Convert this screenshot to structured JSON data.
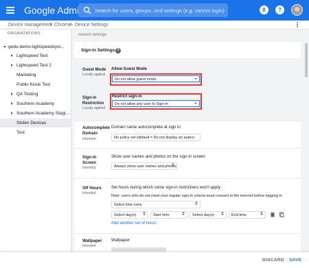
{
  "header": {
    "brand": "Google",
    "product": "Admin",
    "search_placeholder": "Search for users, groups, and settings (e.g. cannot login)",
    "icons": [
      "menu-icon",
      "search-icon",
      "help-number-icon",
      "help-icon",
      "account-avatar"
    ],
    "badge_label": "8",
    "help_label": "?",
    "brand_color": "#1a73e8"
  },
  "breadcrumb": {
    "items": [
      "Device management",
      "Chrome",
      "Device Settings"
    ],
    "separator": ">"
  },
  "orgs": {
    "header": "ORGANIZATIONS",
    "items": [
      {
        "label": "gedu-demo-lightspeedsyst...",
        "expanded": true
      },
      {
        "label": "Lightspeed Test",
        "expanded": false
      },
      {
        "label": "Lightspeed Test 2",
        "expanded": false
      },
      {
        "label": "Marketing",
        "expanded": null
      },
      {
        "label": "Public Kiosk Test",
        "expanded": null
      },
      {
        "label": "QA Testing",
        "expanded": false
      },
      {
        "label": "Southern Academy",
        "expanded": false
      },
      {
        "label": "Southern Academy Stagi...",
        "expanded": false
      },
      {
        "label": "Stolen Devices",
        "selected": true
      },
      {
        "label": "Test",
        "expanded": null
      }
    ]
  },
  "settings": {
    "search_placeholder": "Search settings",
    "section_title": "Sign-in Settings",
    "section_help": "?",
    "guest_mode": {
      "label": "Guest Mode",
      "sub": "Locally applied",
      "title": "Allow Guest Mode",
      "value": "Do not allow guest mode"
    },
    "sign_in_restriction": {
      "label": "Sign-in Restriction",
      "sub": "Locally applied",
      "title": "Restrict sign-in",
      "value": "Do not allow any user to Sign-in"
    },
    "autocomplete": {
      "label": "Autocomplete Domain",
      "sub": "Inherited",
      "title": "Domain name autocomplete at sign in",
      "value": "No policy set (default = Do not display an autocc"
    },
    "signin_screen": {
      "label": "Sign-in Screen",
      "sub": "Inherited",
      "title": "Show user names and photos on the sign-in screen",
      "value": "Always show user names and photos"
    },
    "off_hours": {
      "label": "Off Hours",
      "sub": "Inherited",
      "title": "Set hours during which some sign-in restrictions won't apply.",
      "note": "Note: users who do not meet your regular sign-in criteria must connect to the internet before logging in.",
      "timezone": "Select time zone",
      "start_day": "Select day(s)",
      "start_time": "Start time",
      "end_day": "Select day(s)",
      "end_time": "End time",
      "add_link": "Add another set of hours"
    },
    "wallpaper": {
      "label": "Wallpaper",
      "sub": "Inherited",
      "title": "Wallpaper"
    }
  },
  "footer": {
    "discard": "DISCARD",
    "save": "SAVE"
  },
  "colors": {
    "highlight": "#e53935",
    "accent": "#1a73e8"
  }
}
